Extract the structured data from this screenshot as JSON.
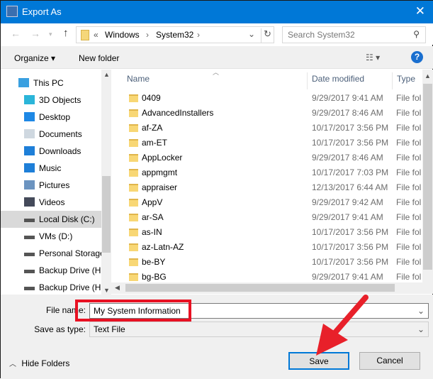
{
  "window": {
    "title": "Export As",
    "close": "✕"
  },
  "address": {
    "path": [
      "«",
      "Windows",
      "›",
      "System32",
      "›"
    ],
    "search_placeholder": "Search System32"
  },
  "toolbar": {
    "organize": "Organize ▾",
    "new_folder": "New folder",
    "view": "☷ ▾",
    "help": "?"
  },
  "sidebar": [
    {
      "label": "This PC",
      "icon": "computer-icon",
      "color": "#3aa0e0"
    },
    {
      "label": "3D Objects",
      "icon": "cube-icon",
      "color": "#2bb5d9"
    },
    {
      "label": "Desktop",
      "icon": "desktop-icon",
      "color": "#1e88e5"
    },
    {
      "label": "Documents",
      "icon": "document-icon",
      "color": "#cfd8e0"
    },
    {
      "label": "Downloads",
      "icon": "download-icon",
      "color": "#1e7fd8"
    },
    {
      "label": "Music",
      "icon": "music-icon",
      "color": "#1e7fd8"
    },
    {
      "label": "Pictures",
      "icon": "pictures-icon",
      "color": "#6c94c0"
    },
    {
      "label": "Videos",
      "icon": "videos-icon",
      "color": "#444a5a"
    },
    {
      "label": "Local Disk (C:)",
      "icon": "drive-icon",
      "color": "#555"
    },
    {
      "label": "VMs (D:)",
      "icon": "drive-icon",
      "color": "#555"
    },
    {
      "label": "Personal Storage",
      "icon": "drive-icon",
      "color": "#555"
    },
    {
      "label": "Backup Drive (H:)",
      "icon": "drive-icon",
      "color": "#555"
    },
    {
      "label": "Backup Drive (H:)",
      "icon": "drive-icon",
      "color": "#555"
    }
  ],
  "columns": {
    "name": "Name",
    "date": "Date modified",
    "type": "Type"
  },
  "files": [
    {
      "name": "0409",
      "date": "9/29/2017 9:41 AM",
      "type": "File fol"
    },
    {
      "name": "AdvancedInstallers",
      "date": "9/29/2017 8:46 AM",
      "type": "File fol"
    },
    {
      "name": "af-ZA",
      "date": "10/17/2017 3:56 PM",
      "type": "File fol"
    },
    {
      "name": "am-ET",
      "date": "10/17/2017 3:56 PM",
      "type": "File fol"
    },
    {
      "name": "AppLocker",
      "date": "9/29/2017 8:46 AM",
      "type": "File fol"
    },
    {
      "name": "appmgmt",
      "date": "10/17/2017 7:03 PM",
      "type": "File fol"
    },
    {
      "name": "appraiser",
      "date": "12/13/2017 6:44 AM",
      "type": "File fol"
    },
    {
      "name": "AppV",
      "date": "9/29/2017 9:42 AM",
      "type": "File fol"
    },
    {
      "name": "ar-SA",
      "date": "9/29/2017 9:41 AM",
      "type": "File fol"
    },
    {
      "name": "as-IN",
      "date": "10/17/2017 3:56 PM",
      "type": "File fol"
    },
    {
      "name": "az-Latn-AZ",
      "date": "10/17/2017 3:56 PM",
      "type": "File fol"
    },
    {
      "name": "be-BY",
      "date": "10/17/2017 3:56 PM",
      "type": "File fol"
    },
    {
      "name": "bg-BG",
      "date": "9/29/2017 9:41 AM",
      "type": "File fol"
    }
  ],
  "form": {
    "file_name_label": "File name:",
    "file_name": "My System Information",
    "type_label": "Save as type:",
    "type_value": "Text File"
  },
  "buttons": {
    "hide_folders": "Hide Folders",
    "save": "Save",
    "cancel": "Cancel"
  },
  "colors": {
    "titlebar": "#0078d7",
    "highlight": "#e81123",
    "arrow": "#e8202a"
  }
}
